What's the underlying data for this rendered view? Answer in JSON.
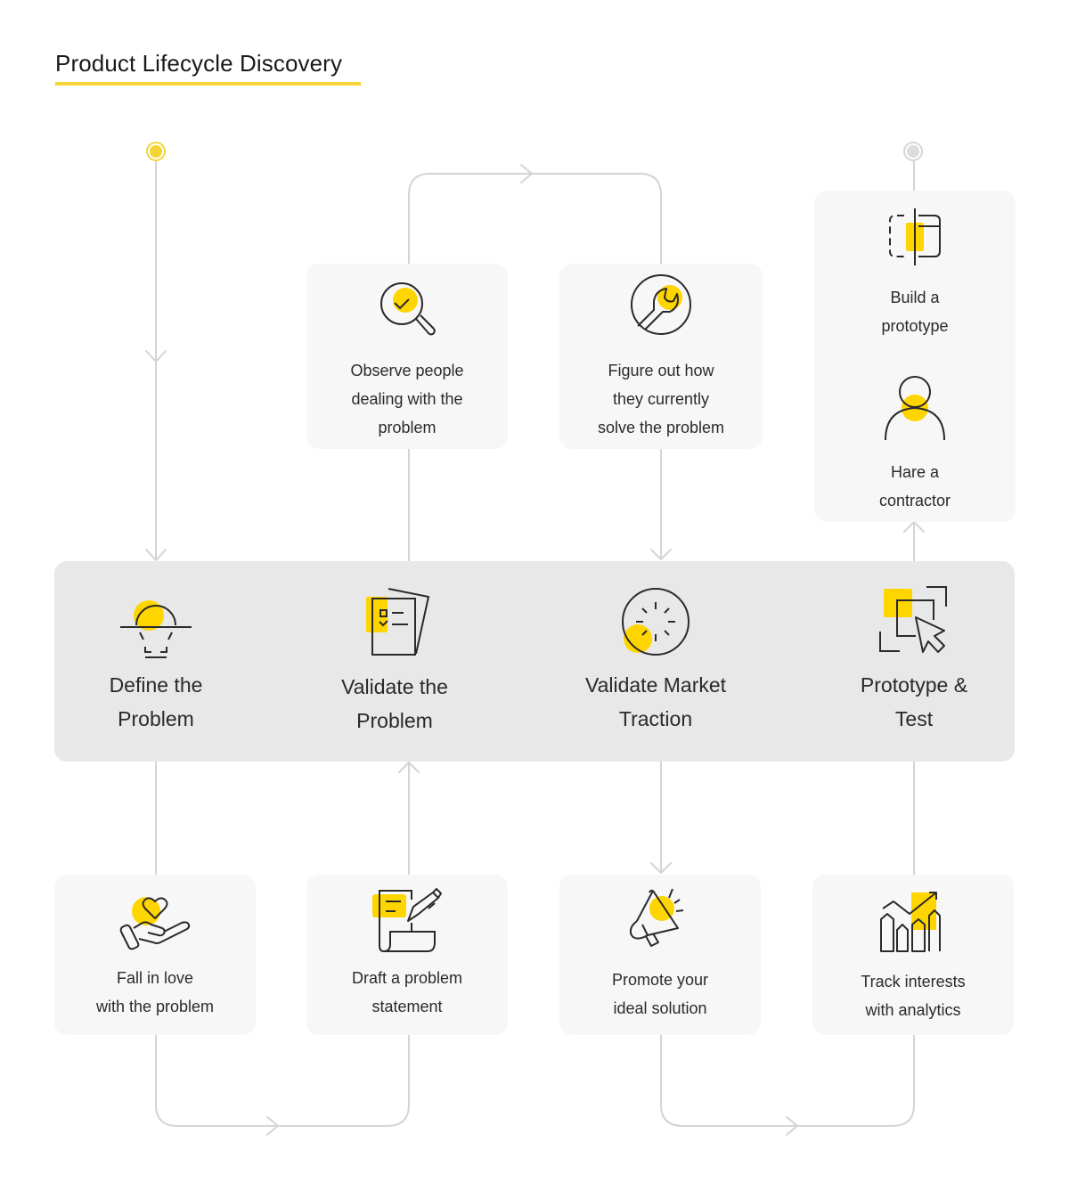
{
  "title": "Product Lifecycle Discovery",
  "colors": {
    "accent": "#FFD500",
    "underline": "#F4D535",
    "band": "#E8E8E8",
    "card": "#F7F7F7",
    "connector": "#D4D4D4",
    "ink": "#2a2a2a"
  },
  "flow": {
    "start_marker": "start",
    "end_marker": "end"
  },
  "stages": [
    {
      "id": "define",
      "icon": "lightbulb-icon",
      "label_line1": "Define the",
      "label_line2": "Problem"
    },
    {
      "id": "validate-problem",
      "icon": "checklist-documents-icon",
      "label_line1": "Validate the",
      "label_line2": "Problem"
    },
    {
      "id": "validate-market",
      "icon": "loading-spinner-icon",
      "label_line1": "Validate Market",
      "label_line2": "Traction"
    },
    {
      "id": "prototype-test",
      "icon": "cursor-select-icon",
      "label_line1": "Prototype &",
      "label_line2": "Test"
    }
  ],
  "top_steps": [
    {
      "id": "observe",
      "icon": "magnifier-check-icon",
      "lines": [
        "Observe people",
        "dealing with the",
        "problem"
      ]
    },
    {
      "id": "figure-out",
      "icon": "wrench-icon",
      "lines": [
        "Figure out how",
        "they currently",
        "solve the problem"
      ]
    },
    {
      "id": "build-prototype",
      "icon": "prototype-frame-icon",
      "lines": [
        "Build a",
        "prototype"
      ]
    },
    {
      "id": "hire-contractor",
      "icon": "person-icon",
      "lines": [
        "Hare a",
        "contractor"
      ]
    }
  ],
  "bottom_steps": [
    {
      "id": "fall-in-love",
      "icon": "hand-heart-icon",
      "lines": [
        "Fall in love",
        "with the problem"
      ]
    },
    {
      "id": "draft-statement",
      "icon": "document-pen-icon",
      "lines": [
        "Draft a problem",
        "statement"
      ]
    },
    {
      "id": "promote",
      "icon": "megaphone-icon",
      "lines": [
        "Promote your",
        "ideal solution"
      ]
    },
    {
      "id": "track-analytics",
      "icon": "analytics-chart-icon",
      "lines": [
        "Track interests",
        "with analytics"
      ]
    }
  ]
}
